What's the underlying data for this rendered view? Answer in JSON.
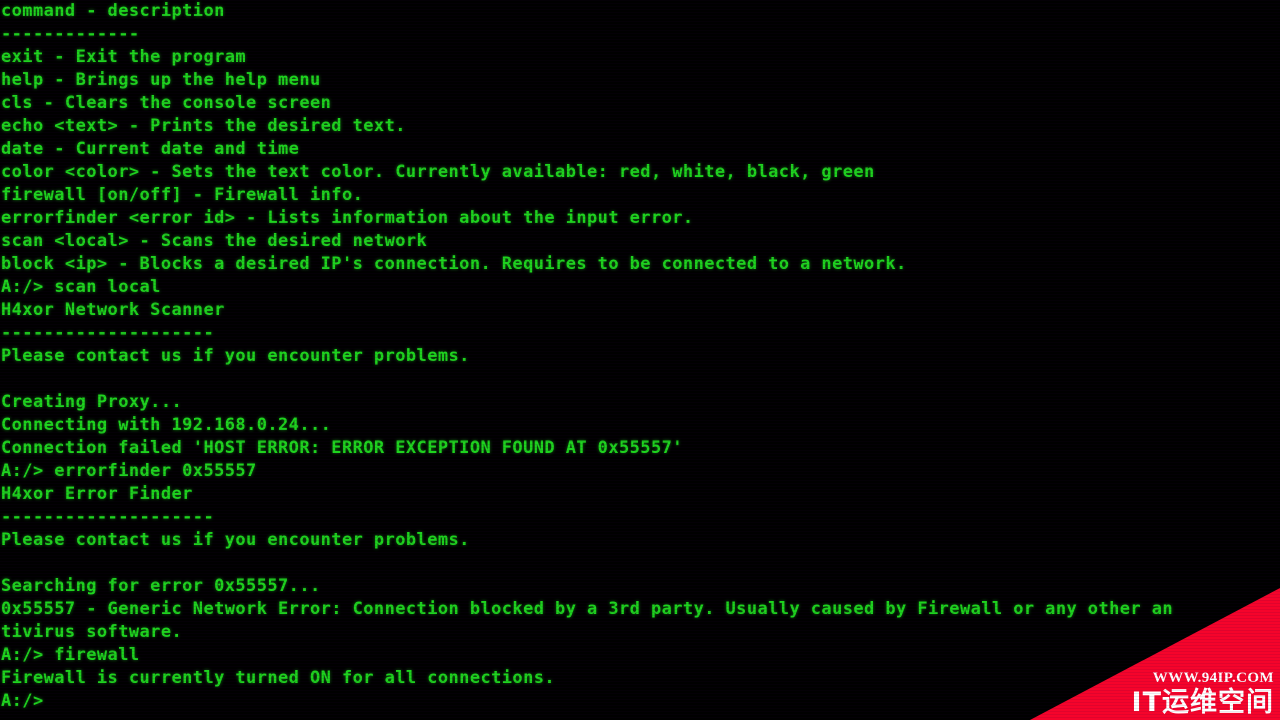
{
  "terminal": {
    "background_color": "#000000",
    "text_color": "#1ed41e",
    "prompt": "A:/>",
    "lines": [
      "command - description",
      "-------------",
      "exit - Exit the program",
      "help - Brings up the help menu",
      "cls - Clears the console screen",
      "echo <text> - Prints the desired text.",
      "date - Current date and time",
      "color <color> - Sets the text color. Currently available: red, white, black, green",
      "firewall [on/off] - Firewall info.",
      "errorfinder <error id> - Lists information about the input error.",
      "scan <local> - Scans the desired network",
      "block <ip> - Blocks a desired IP's connection. Requires to be connected to a network.",
      "A:/> scan local",
      "H4xor Network Scanner",
      "--------------------",
      "Please contact us if you encounter problems.",
      "",
      "Creating Proxy...",
      "Connecting with 192.168.0.24...",
      "Connection failed 'HOST ERROR: ERROR EXCEPTION FOUND AT 0x55557'",
      "A:/> errorfinder 0x55557",
      "H4xor Error Finder",
      "--------------------",
      "Please contact us if you encounter problems.",
      "",
      "Searching for error 0x55557...",
      "0x55557 - Generic Network Error: Connection blocked by a 3rd party. Usually caused by Firewall or any other an",
      "tivirus software.",
      "A:/> firewall",
      "Firewall is currently turned ON for all connections.",
      "A:/>"
    ]
  },
  "watermark": {
    "url": "WWW.94IP.COM",
    "brand": "IT运维空间",
    "color": "#f5042b",
    "text_color": "#ffffff"
  }
}
